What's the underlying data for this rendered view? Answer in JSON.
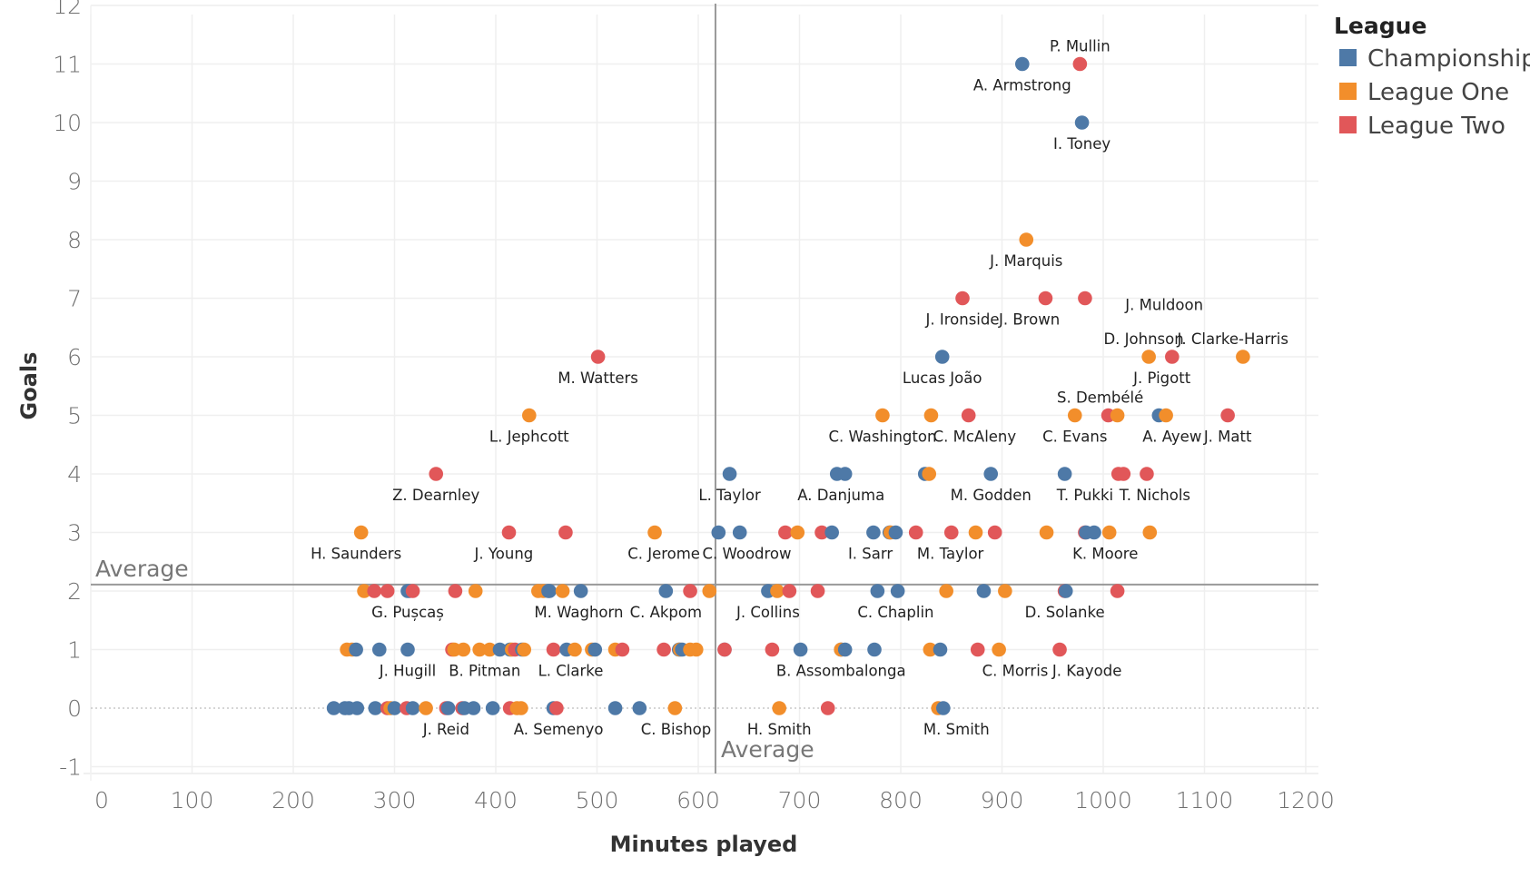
{
  "chart_data": {
    "type": "scatter",
    "title": "",
    "xlabel": "Minutes played",
    "ylabel": "Goals",
    "xlim": [
      -5,
      1225
    ],
    "ylim": [
      -1.3,
      12.3
    ],
    "x_ticks": [
      "0",
      "100",
      "200",
      "300",
      "400",
      "500",
      "600",
      "700",
      "800",
      "900",
      "1000",
      "1100",
      "1200"
    ],
    "x_tick_values": [
      0,
      100,
      200,
      300,
      400,
      500,
      600,
      700,
      800,
      900,
      1000,
      1100,
      1200
    ],
    "y_ticks": [
      "-1",
      "0",
      "1",
      "2",
      "3",
      "4",
      "5",
      "6",
      "7",
      "8",
      "9",
      "10",
      "11",
      "12"
    ],
    "y_tick_values": [
      -1,
      0,
      1,
      2,
      3,
      4,
      5,
      6,
      7,
      8,
      9,
      10,
      11,
      12
    ],
    "grid": true,
    "reference_lines": {
      "x_average": 617,
      "y_average": 2.11,
      "x_label": "Average",
      "y_label": "Average"
    },
    "legend": {
      "title": "League",
      "position": "top-right",
      "entries": [
        {
          "name": "Championship",
          "color": "#4e79a7"
        },
        {
          "name": "League One",
          "color": "#f28e2b"
        },
        {
          "name": "League Two",
          "color": "#e15759"
        }
      ]
    },
    "series": [
      {
        "name": "Championship",
        "color": "#4e79a7",
        "points": [
          [
            920,
            11,
            "A. Armstrong"
          ],
          [
            979,
            10,
            "I. Toney"
          ],
          [
            841,
            6,
            "Lucas João"
          ],
          [
            1055,
            5,
            "A. Ayew"
          ],
          [
            631,
            4,
            ""
          ],
          [
            737,
            4,
            ""
          ],
          [
            745,
            4,
            ""
          ],
          [
            824,
            4,
            ""
          ],
          [
            889,
            4,
            "M. Godden"
          ],
          [
            962,
            4,
            "T. Pukki"
          ],
          [
            620,
            3,
            ""
          ],
          [
            641,
            3,
            ""
          ],
          [
            732,
            3,
            ""
          ],
          [
            773,
            3,
            ""
          ],
          [
            789,
            3,
            ""
          ],
          [
            795,
            3,
            ""
          ],
          [
            983,
            3,
            ""
          ],
          [
            991,
            3,
            ""
          ],
          [
            315,
            2,
            ""
          ],
          [
            313,
            2,
            ""
          ],
          [
            452,
            2,
            ""
          ],
          [
            453,
            2,
            ""
          ],
          [
            484,
            2,
            ""
          ],
          [
            568,
            2,
            ""
          ],
          [
            669,
            2,
            ""
          ],
          [
            777,
            2,
            ""
          ],
          [
            797,
            2,
            ""
          ],
          [
            882,
            2,
            ""
          ],
          [
            963,
            2,
            ""
          ],
          [
            262,
            1,
            ""
          ],
          [
            285,
            1,
            ""
          ],
          [
            313,
            1,
            ""
          ],
          [
            404,
            1,
            ""
          ],
          [
            414,
            1,
            ""
          ],
          [
            426,
            1,
            ""
          ],
          [
            470,
            1,
            ""
          ],
          [
            498,
            1,
            ""
          ],
          [
            581,
            1,
            ""
          ],
          [
            584,
            1,
            ""
          ],
          [
            626,
            1,
            ""
          ],
          [
            701,
            1,
            ""
          ],
          [
            741,
            1,
            ""
          ],
          [
            745,
            1,
            ""
          ],
          [
            774,
            1,
            ""
          ],
          [
            839,
            1,
            ""
          ],
          [
            240,
            0,
            ""
          ],
          [
            251,
            0,
            ""
          ],
          [
            255,
            0,
            ""
          ],
          [
            263,
            0,
            ""
          ],
          [
            281,
            0,
            ""
          ],
          [
            300,
            0,
            ""
          ],
          [
            318,
            0,
            ""
          ],
          [
            353,
            0,
            ""
          ],
          [
            369,
            0,
            ""
          ],
          [
            378,
            0,
            ""
          ],
          [
            397,
            0,
            ""
          ],
          [
            457,
            0,
            ""
          ],
          [
            518,
            0,
            ""
          ],
          [
            542,
            0,
            ""
          ],
          [
            842,
            0,
            "M. Smith"
          ]
        ]
      },
      {
        "name": "League One",
        "color": "#f28e2b",
        "points": [
          [
            924,
            8,
            ""
          ],
          [
            1045,
            6,
            "D. Johnson"
          ],
          [
            1138,
            6,
            "J. Clarke-Harris"
          ],
          [
            433,
            5,
            "L. Jephcott"
          ],
          [
            782,
            5,
            "C. Washington"
          ],
          [
            830,
            5,
            ""
          ],
          [
            972,
            5,
            "C. Evans"
          ],
          [
            1014,
            5,
            ""
          ],
          [
            1062,
            5,
            ""
          ],
          [
            828,
            4,
            ""
          ],
          [
            267,
            3,
            "H. Saunders"
          ],
          [
            557,
            3,
            "C. Jerome"
          ],
          [
            698,
            3,
            ""
          ],
          [
            790,
            3,
            ""
          ],
          [
            874,
            3,
            ""
          ],
          [
            944,
            3,
            ""
          ],
          [
            1006,
            3,
            ""
          ],
          [
            1046,
            3,
            ""
          ],
          [
            270,
            2,
            ""
          ],
          [
            380,
            2,
            ""
          ],
          [
            442,
            2,
            ""
          ],
          [
            447,
            2,
            ""
          ],
          [
            466,
            2,
            ""
          ],
          [
            611,
            2,
            ""
          ],
          [
            678,
            2,
            ""
          ],
          [
            845,
            2,
            ""
          ],
          [
            903,
            2,
            ""
          ],
          [
            253,
            1,
            ""
          ],
          [
            258,
            1,
            ""
          ],
          [
            359,
            1,
            ""
          ],
          [
            368,
            1,
            ""
          ],
          [
            384,
            1,
            ""
          ],
          [
            394,
            1,
            ""
          ],
          [
            416,
            1,
            ""
          ],
          [
            428,
            1,
            ""
          ],
          [
            478,
            1,
            ""
          ],
          [
            495,
            1,
            ""
          ],
          [
            518,
            1,
            ""
          ],
          [
            582,
            1,
            ""
          ],
          [
            592,
            1,
            ""
          ],
          [
            598,
            1,
            ""
          ],
          [
            741,
            1,
            ""
          ],
          [
            829,
            1,
            ""
          ],
          [
            897,
            1,
            ""
          ],
          [
            296,
            0,
            ""
          ],
          [
            331,
            0,
            ""
          ],
          [
            421,
            0,
            ""
          ],
          [
            425,
            0,
            ""
          ],
          [
            577,
            0,
            "C. Bishop"
          ],
          [
            680,
            0,
            "H. Smith"
          ],
          [
            837,
            0,
            ""
          ]
        ]
      },
      {
        "name": "League Two",
        "color": "#e15759",
        "points": [
          [
            977,
            11,
            "P. Mullin"
          ],
          [
            861,
            7,
            "J. Ironside"
          ],
          [
            943,
            7,
            "J. Brown"
          ],
          [
            982,
            7,
            "J. Muldoon"
          ],
          [
            1068,
            6,
            "J. Pigott"
          ],
          [
            501,
            6,
            "M. Watters"
          ],
          [
            867,
            5,
            "C. McAleny"
          ],
          [
            1005,
            5,
            "S. Dembélé"
          ],
          [
            1123,
            5,
            "J. Matt"
          ],
          [
            341,
            4,
            "Z. Dearnley"
          ],
          [
            1015,
            4,
            ""
          ],
          [
            1020,
            4,
            "T. Nichols"
          ],
          [
            1043,
            4,
            ""
          ],
          [
            413,
            3,
            "J. Young"
          ],
          [
            469,
            3,
            ""
          ],
          [
            686,
            3,
            ""
          ],
          [
            722,
            3,
            ""
          ],
          [
            815,
            3,
            ""
          ],
          [
            850,
            3,
            ""
          ],
          [
            893,
            3,
            ""
          ],
          [
            982,
            3,
            ""
          ],
          [
            280,
            2,
            ""
          ],
          [
            293,
            2,
            ""
          ],
          [
            318,
            2,
            ""
          ],
          [
            360,
            2,
            ""
          ],
          [
            592,
            2,
            ""
          ],
          [
            690,
            2,
            ""
          ],
          [
            718,
            2,
            ""
          ],
          [
            962,
            2,
            ""
          ],
          [
            1014,
            2,
            ""
          ],
          [
            357,
            1,
            ""
          ],
          [
            419,
            1,
            ""
          ],
          [
            457,
            1,
            ""
          ],
          [
            525,
            1,
            ""
          ],
          [
            566,
            1,
            ""
          ],
          [
            626,
            1,
            ""
          ],
          [
            673,
            1,
            ""
          ],
          [
            876,
            1,
            ""
          ],
          [
            957,
            1,
            ""
          ],
          [
            293,
            0,
            ""
          ],
          [
            312,
            0,
            ""
          ],
          [
            351,
            0,
            ""
          ],
          [
            367,
            0,
            ""
          ],
          [
            414,
            0,
            ""
          ],
          [
            460,
            0,
            ""
          ],
          [
            728,
            0,
            ""
          ]
        ]
      }
    ],
    "labels": [
      {
        "text": "P. Mullin",
        "x": 977,
        "y": 11,
        "pos": "above"
      },
      {
        "text": "A. Armstrong",
        "x": 920,
        "y": 11,
        "pos": "below"
      },
      {
        "text": "I. Toney",
        "x": 979,
        "y": 10,
        "pos": "below"
      },
      {
        "text": "J. Marquis",
        "x": 924,
        "y": 8,
        "pos": "below"
      },
      {
        "text": "J. Ironside",
        "x": 861,
        "y": 7,
        "pos": "below"
      },
      {
        "text": "J. Brown",
        "x": 927,
        "y": 7,
        "pos": "below"
      },
      {
        "text": "J. Muldoon",
        "x": 1020,
        "y": 7,
        "pos": "right"
      },
      {
        "text": "D. Johnson",
        "x": 1040,
        "y": 6,
        "pos": "above"
      },
      {
        "text": "J. Clarke-Harris",
        "x": 1128,
        "y": 6,
        "pos": "above"
      },
      {
        "text": "M. Watters",
        "x": 501,
        "y": 6,
        "pos": "below"
      },
      {
        "text": "Lucas João",
        "x": 841,
        "y": 6,
        "pos": "below"
      },
      {
        "text": "J. Pigott",
        "x": 1058,
        "y": 6,
        "pos": "below"
      },
      {
        "text": "S. Dembélé",
        "x": 997,
        "y": 5,
        "pos": "above"
      },
      {
        "text": "L. Jephcott",
        "x": 433,
        "y": 5,
        "pos": "below"
      },
      {
        "text": "C. Washington",
        "x": 782,
        "y": 5,
        "pos": "below"
      },
      {
        "text": "C. McAleny",
        "x": 873,
        "y": 5,
        "pos": "below"
      },
      {
        "text": "C. Evans",
        "x": 972,
        "y": 5,
        "pos": "below"
      },
      {
        "text": "A. Ayew",
        "x": 1068,
        "y": 5,
        "pos": "below"
      },
      {
        "text": "J. Matt",
        "x": 1123,
        "y": 5,
        "pos": "below"
      },
      {
        "text": "Z. Dearnley",
        "x": 341,
        "y": 4,
        "pos": "below"
      },
      {
        "text": "L. Taylor",
        "x": 631,
        "y": 4,
        "pos": "below"
      },
      {
        "text": "A. Danjuma",
        "x": 741,
        "y": 4,
        "pos": "below"
      },
      {
        "text": "M. Godden",
        "x": 889,
        "y": 4,
        "pos": "below"
      },
      {
        "text": "T. Pukki",
        "x": 982,
        "y": 4,
        "pos": "below"
      },
      {
        "text": "T. Nichols",
        "x": 1051,
        "y": 4,
        "pos": "below"
      },
      {
        "text": "H. Saunders",
        "x": 262,
        "y": 3,
        "pos": "below"
      },
      {
        "text": "J. Young",
        "x": 408,
        "y": 3,
        "pos": "below"
      },
      {
        "text": "C. Jerome",
        "x": 566,
        "y": 3,
        "pos": "below"
      },
      {
        "text": "C. Woodrow",
        "x": 648,
        "y": 3,
        "pos": "below"
      },
      {
        "text": "I. Sarr",
        "x": 770,
        "y": 3,
        "pos": "below"
      },
      {
        "text": "M. Taylor",
        "x": 849,
        "y": 3,
        "pos": "below"
      },
      {
        "text": "K. Moore",
        "x": 1002,
        "y": 3,
        "pos": "below"
      },
      {
        "text": "G. Pușcaș",
        "x": 313,
        "y": 2,
        "pos": "below"
      },
      {
        "text": "M. Waghorn",
        "x": 482,
        "y": 2,
        "pos": "below"
      },
      {
        "text": "C. Akpom",
        "x": 568,
        "y": 2,
        "pos": "below"
      },
      {
        "text": "J. Collins",
        "x": 669,
        "y": 2,
        "pos": "below"
      },
      {
        "text": "C. Chaplin",
        "x": 795,
        "y": 2,
        "pos": "below"
      },
      {
        "text": "D. Solanke",
        "x": 962,
        "y": 2,
        "pos": "below"
      },
      {
        "text": "J. Hugill",
        "x": 313,
        "y": 1,
        "pos": "below"
      },
      {
        "text": "B. Pitman",
        "x": 389,
        "y": 1,
        "pos": "below"
      },
      {
        "text": "L. Clarke",
        "x": 474,
        "y": 1,
        "pos": "below"
      },
      {
        "text": "B. Assombalonga",
        "x": 741,
        "y": 1,
        "pos": "below"
      },
      {
        "text": "C. Morris",
        "x": 913,
        "y": 1,
        "pos": "below"
      },
      {
        "text": "J. Kayode",
        "x": 984,
        "y": 1,
        "pos": "below"
      },
      {
        "text": "J. Reid",
        "x": 351,
        "y": 0,
        "pos": "below"
      },
      {
        "text": "A. Semenyo",
        "x": 462,
        "y": 0,
        "pos": "below"
      },
      {
        "text": "C. Bishop",
        "x": 578,
        "y": 0,
        "pos": "below"
      },
      {
        "text": "H. Smith",
        "x": 680,
        "y": 0,
        "pos": "below"
      },
      {
        "text": "M. Smith",
        "x": 855,
        "y": 0,
        "pos": "below"
      }
    ]
  }
}
